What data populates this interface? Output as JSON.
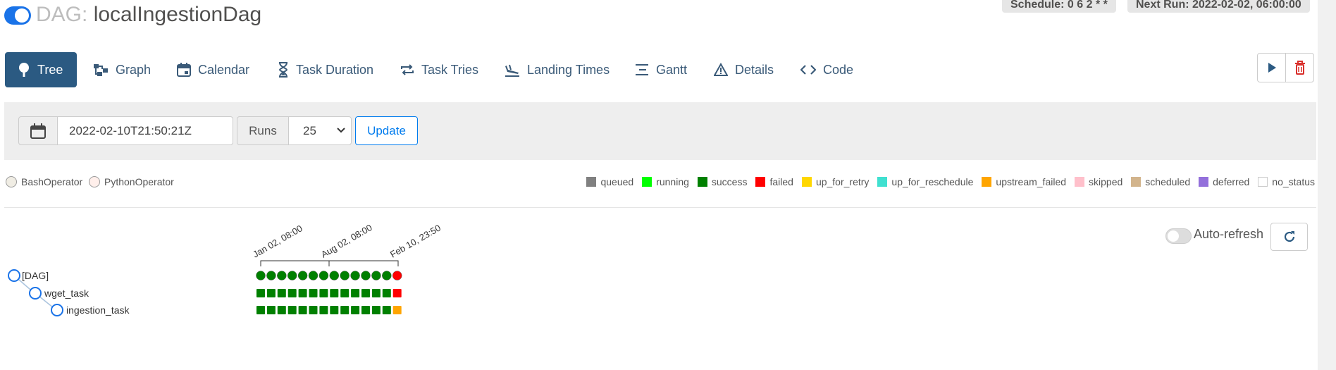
{
  "header": {
    "dag_prefix": "DAG:",
    "dag_name": "localIngestionDag",
    "schedule_label": "Schedule: 0 6 2 * *",
    "next_run_label": "Next Run: 2022-02-02, 06:00:00"
  },
  "tabs": [
    {
      "label": "Tree",
      "icon": "tree-icon",
      "active": true
    },
    {
      "label": "Graph",
      "icon": "graph-icon"
    },
    {
      "label": "Calendar",
      "icon": "calendar-icon"
    },
    {
      "label": "Task Duration",
      "icon": "hourglass-icon"
    },
    {
      "label": "Task Tries",
      "icon": "repeat-icon"
    },
    {
      "label": "Landing Times",
      "icon": "plane-landing-icon"
    },
    {
      "label": "Gantt",
      "icon": "gantt-icon"
    },
    {
      "label": "Details",
      "icon": "warning-triangle-icon"
    },
    {
      "label": "Code",
      "icon": "code-icon"
    }
  ],
  "actions": {
    "trigger_icon": "play-icon",
    "delete_icon": "trash-icon"
  },
  "filter": {
    "date_value": "2022-02-10T21:50:21Z",
    "runs_label": "Runs",
    "runs_value": "25",
    "update_label": "Update"
  },
  "operators": [
    {
      "name": "BashOperator",
      "color": "#f0ede4"
    },
    {
      "name": "PythonOperator",
      "color": "#ffefeb"
    }
  ],
  "legend": [
    {
      "label": "queued",
      "color": "#808080"
    },
    {
      "label": "running",
      "color": "#00ff00"
    },
    {
      "label": "success",
      "color": "#008000"
    },
    {
      "label": "failed",
      "color": "#ff0000"
    },
    {
      "label": "up_for_retry",
      "color": "#ffd700"
    },
    {
      "label": "up_for_reschedule",
      "color": "#40e0d0"
    },
    {
      "label": "upstream_failed",
      "color": "#ffa500"
    },
    {
      "label": "skipped",
      "color": "#ffc0cb"
    },
    {
      "label": "scheduled",
      "color": "#d2b48c"
    },
    {
      "label": "deferred",
      "color": "#9370db"
    },
    {
      "label": "no_status",
      "color": "#ffffff"
    }
  ],
  "auto_refresh": {
    "label": "Auto-refresh",
    "enabled": false
  },
  "tree": {
    "nodes": [
      "[DAG]",
      "wget_task",
      "ingestion_task"
    ],
    "date_labels": [
      "Jan 02, 08:00",
      "Aug 02, 08:00",
      "Feb 10, 23:50"
    ],
    "dag_runs": [
      "success",
      "success",
      "success",
      "success",
      "success",
      "success",
      "success",
      "success",
      "success",
      "success",
      "success",
      "success",
      "success",
      "failed"
    ],
    "task_instances": {
      "wget_task": [
        "success",
        "success",
        "success",
        "success",
        "success",
        "success",
        "success",
        "success",
        "success",
        "success",
        "success",
        "success",
        "success",
        "failed"
      ],
      "ingestion_task": [
        "success",
        "success",
        "success",
        "success",
        "success",
        "success",
        "success",
        "success",
        "success",
        "success",
        "success",
        "success",
        "success",
        "upstream_failed"
      ]
    }
  }
}
